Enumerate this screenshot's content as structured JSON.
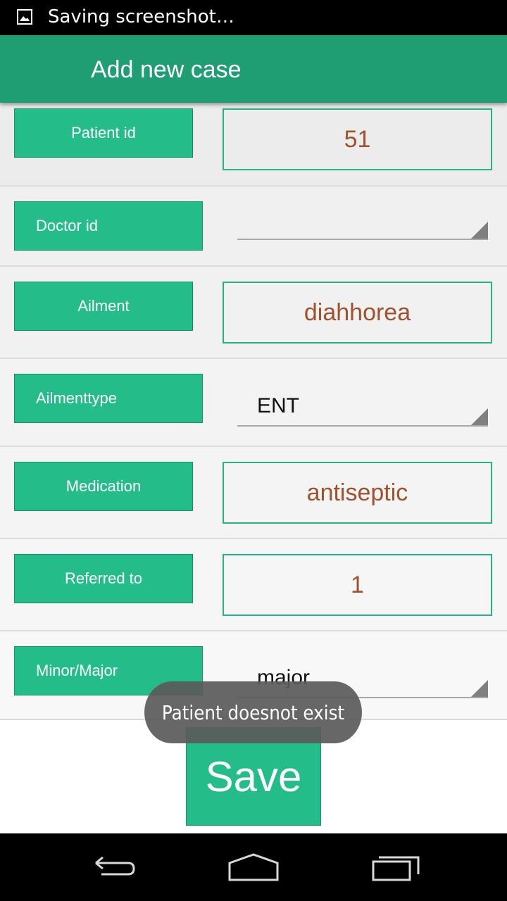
{
  "status_bar": {
    "notification_icon": "image-icon",
    "text": "Saving screenshot…"
  },
  "action_bar": {
    "title": "Add new case"
  },
  "form": {
    "patient_id": {
      "label": "Patient id",
      "value": "51"
    },
    "doctor_id": {
      "label": "Doctor id",
      "selected": ""
    },
    "ailment": {
      "label": "Ailment",
      "value": "diahhorea"
    },
    "ailment_type": {
      "label": "Ailmenttype",
      "selected": "ENT"
    },
    "medication": {
      "label": "Medication",
      "value": "antiseptic"
    },
    "referred_to": {
      "label": "Referred to",
      "value": "1"
    },
    "severity": {
      "label": "Minor/Major",
      "selected": "major"
    }
  },
  "save_button": {
    "label": "Save"
  },
  "toast": {
    "message": "Patient doesnot exist"
  },
  "nav_bar": {
    "back": "back-icon",
    "home": "home-icon",
    "recents": "recents-icon"
  },
  "colors": {
    "action_bar": "#1e9e72",
    "accent": "#24bd8a",
    "value_text": "#a0522d"
  }
}
